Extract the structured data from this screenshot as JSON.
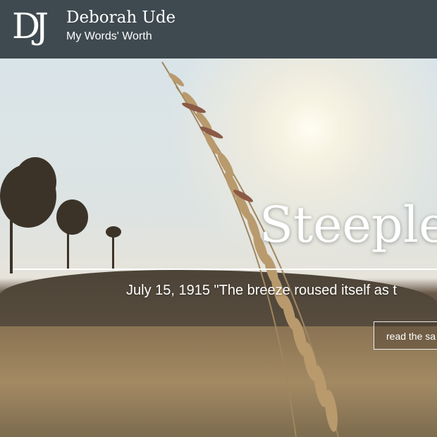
{
  "header": {
    "logo": "DJ",
    "name": "Deborah Ude",
    "tagline": "My Words' Worth"
  },
  "hero": {
    "title": "Steeple S",
    "subtitle": "July 15, 1915 \"The breeze roused itself as t",
    "button_label": "read the sa"
  },
  "colors": {
    "header_bg": "#3f4a50",
    "text": "#ffffff"
  }
}
